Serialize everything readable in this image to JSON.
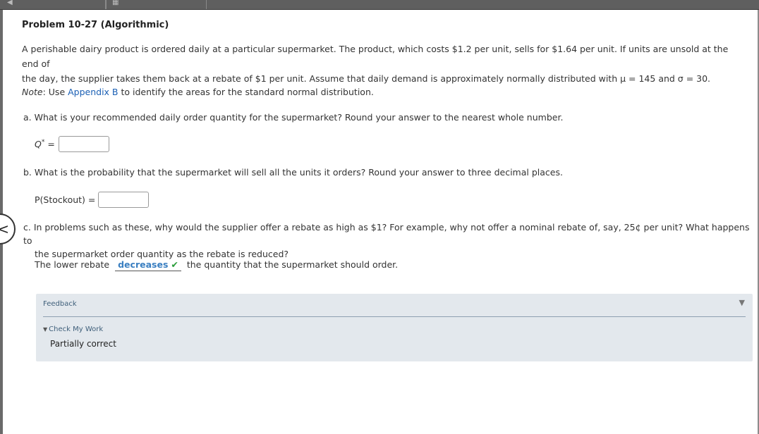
{
  "problem": {
    "title": "Problem 10-27 (Algorithmic)",
    "intro_line1": "A perishable dairy product is ordered daily at a particular supermarket. The product, which costs $1.2 per unit, sells for $1.64 per unit. If units are unsold at the end of",
    "intro_line2": "the day, the supplier takes them back at a rebate of $1 per unit. Assume that daily demand is approximately normally distributed with μ = 145 and σ = 30."
  },
  "note": {
    "label": "Note",
    "text_before": ": Use ",
    "link": "Appendix B",
    "text_after": " to identify the areas for the standard normal distribution."
  },
  "part_a": {
    "question": "a. What is your recommended daily order quantity for the supermarket? Round your answer to the nearest whole number.",
    "label": "Q",
    "label_sup": "*",
    "equals": " =",
    "value": ""
  },
  "part_b": {
    "question": "b. What is the probability that the supermarket will sell all the units it orders? Round your answer to three decimal places.",
    "label": "P(Stockout) =",
    "value": ""
  },
  "part_c": {
    "question_line1": "c. In problems such as these, why would the supplier offer a rebate as high as $1? For example, why not offer a nominal rebate of, say, 25¢ per unit? What happens to",
    "question_line2": "the supermarket order quantity as the rebate is reduced?",
    "answer_before": "The lower rebate",
    "answer_selected": "decreases",
    "answer_mark": "✔",
    "answer_after": "the quantity that the supermarket should order."
  },
  "feedback": {
    "title": "Feedback",
    "toggle_icon": "▼",
    "check_label": "Check My Work",
    "check_icon": "▼",
    "status": "Partially correct"
  },
  "nav": {
    "back_icon": "<"
  },
  "colors": {
    "link": "#1a5fb4",
    "selected_answer": "#3a7fc1",
    "correct_check": "#2a9d3a",
    "feedback_bg": "#e3e8ed"
  }
}
